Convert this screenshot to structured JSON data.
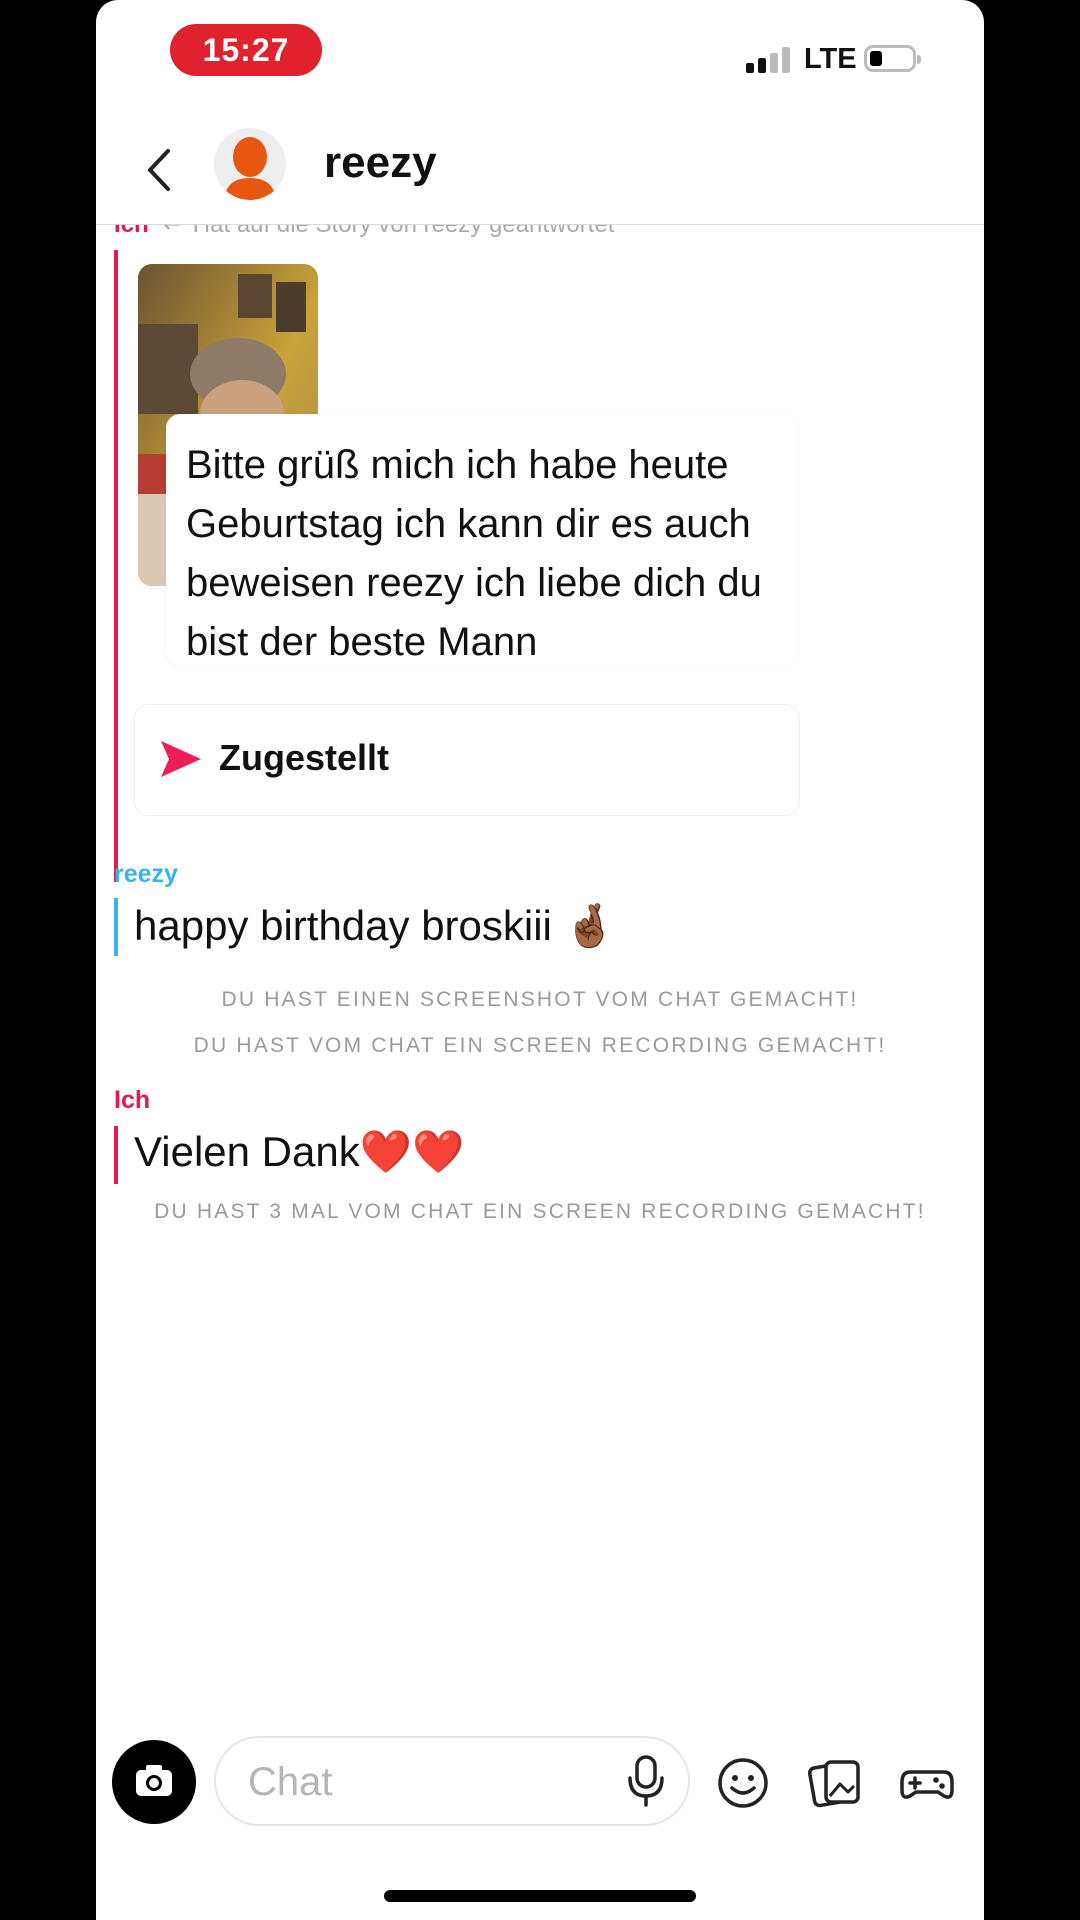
{
  "status_bar": {
    "time": "15:27",
    "network": "LTE",
    "time_pill_color": "#e0212e"
  },
  "header": {
    "contact_name": "reezy",
    "avatar_color": "#e8570f"
  },
  "chat": {
    "reply_context": {
      "sender": "Ich",
      "text": "Hat auf die Story von reezy geantwortet"
    },
    "quoted_message": "Bitte grüß mich ich habe heute Geburtstag ich kann dir es auch beweisen reezy ich liebe dich du bist der beste Mann",
    "delivery_status": "Zugestellt",
    "messages": [
      {
        "sender": "reezy",
        "text": "happy birthday broskiii 🤞🏾",
        "sender_color": "#3ab4e6"
      },
      {
        "sender": "Ich",
        "text": "Vielen Dank❤️❤️",
        "sender_color": "#e01c4d"
      }
    ],
    "system_notices": [
      "DU HAST EINEN SCREENSHOT VOM CHAT GEMACHT!",
      "DU HAST VOM CHAT EIN SCREEN RECORDING GEMACHT!",
      "DU HAST 3 MAL VOM CHAT EIN SCREEN RECORDING GEMACHT!"
    ]
  },
  "composer": {
    "placeholder": "Chat",
    "icons": [
      "camera-icon",
      "microphone-icon",
      "emoji-icon",
      "memories-icon",
      "games-icon"
    ]
  },
  "colors": {
    "sent": "#e01c4d",
    "received": "#3ab4e6",
    "system_text": "#9a9a9a"
  }
}
